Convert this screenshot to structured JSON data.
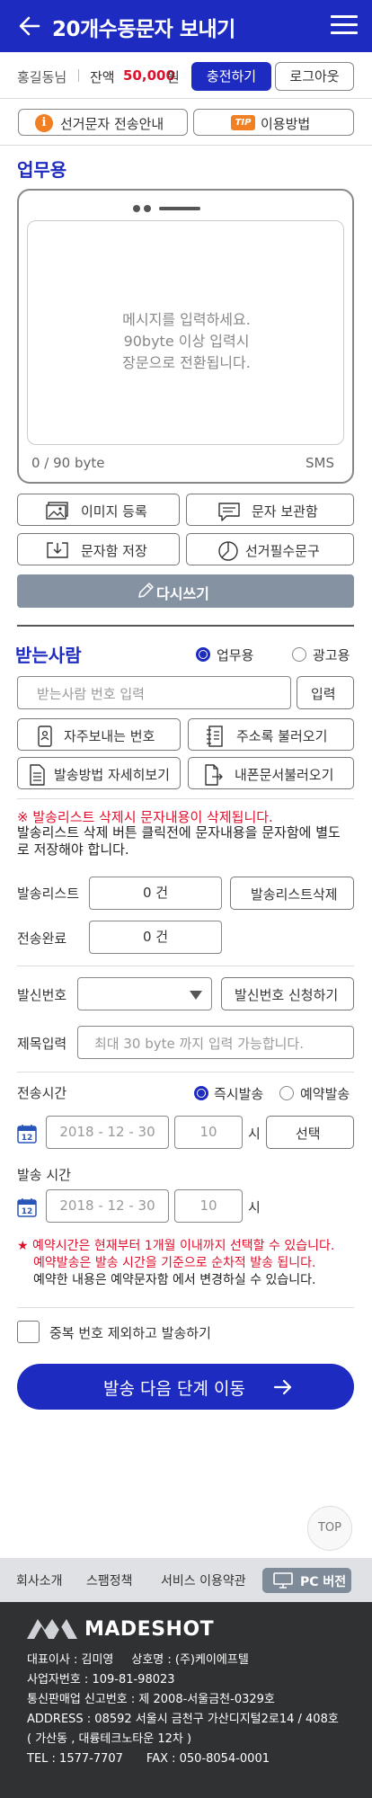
{
  "header": {
    "title": "20개수동문자 보내기",
    "back_icon": "arrow-left-icon",
    "menu_icon": "hamburger-icon"
  },
  "user": {
    "name": "홍길동님",
    "balance_label": "잔액",
    "balance": "50,000",
    "currency": "원",
    "charge": "충전하기",
    "logout": "로그아웃"
  },
  "info_buttons": {
    "election": "선거문자 전송안내",
    "tip_badge": "TIP",
    "usage": "이용방법"
  },
  "compose": {
    "title": "업무용",
    "placeholder_lines": [
      "메시지를 입력하세요.",
      "90byte 이상 입력시",
      "장문으로 전환됩니다."
    ],
    "byte_count": "0 / 90 byte",
    "type": "SMS",
    "buttons": {
      "image": "이미지 등록",
      "storage": "문자 보관함",
      "save": "문자함 저장",
      "election_phrase": "선거필수문구",
      "rewrite": "다시쓰기"
    }
  },
  "recipients": {
    "title": "받는사람",
    "radio_business": "업무용",
    "radio_ad": "광고용",
    "input_placeholder": "받는사람 번호 입력",
    "enter": "입력",
    "frequent": "자주보내는 번호",
    "address_book": "주소록 불러오기",
    "method_detail": "발송방법 자세히보기",
    "phone_docs": "내폰문서불러오기",
    "warn_red": "※ 발송리스트 삭제시 문자내용이 삭제됩니다.",
    "warn_black": "발송리스트 삭제 버튼 클릭전에 문자내용을 문자함에 별도로 저장해야 합니다."
  },
  "counts": {
    "send_list_label": "발송리스트",
    "send_list_value": "0 건",
    "delete_list": "발송리스트삭제",
    "sent_label": "전송완료",
    "sent_value": "0 건"
  },
  "sender": {
    "label": "발신번호",
    "apply": "발신번호 신청하기"
  },
  "subject": {
    "label": "제목입력",
    "placeholder": "최대 30 byte 까지 입력 가능합니다."
  },
  "schedule": {
    "label": "전송시간",
    "immediate": "즉시발송",
    "reserved": "예약발송",
    "date": "2018 - 12 - 30",
    "hour": "10",
    "hour_unit": "시",
    "select": "선택",
    "calendar_day": "12",
    "send_time_label": "발송 시간",
    "date2": "2018 - 12 - 30",
    "hour2": "10"
  },
  "notice": {
    "line1": "★ 예약시간은 현재부터 1개월 이내까지 선택할 수 있습니다.",
    "line2": "예약발송은 발송 시간을 기준으로 순차적 발송 됩니다.",
    "line3": "예약한 내용은 예약문자함 에서 변경하실 수 있습니다."
  },
  "dedupe": "중복 번호 제외하고 발송하기",
  "next": "발송 다음 단계 이동",
  "top": "TOP",
  "footer_nav": {
    "company": "회사소개",
    "spam": "스팸정책",
    "terms": "서비스 이용약관",
    "pc": "PC 버전"
  },
  "footer": {
    "logo": "MADESHOT",
    "ceo": "대표이사 : 김미영",
    "company": "상호명 : (주)케이에프텔",
    "biz_no": "사업자번호 : 109-81-98023",
    "ecommerce": "통신판매업 신고번호 : 제 2008-서울금천-0329호",
    "address": "ADDRESS : 08592 서울시 금천구 가산디지털2로14 / 408호",
    "address2": "( 가산동 , 대륭테크노타운 12차 )",
    "tel": "TEL : 1577-7707",
    "fax": "FAX : 050-8054-0001"
  },
  "colors": {
    "primary": "#1e2bc0",
    "red": "#e0102d",
    "orange": "#f08022",
    "gray_button": "#8492a2",
    "footer_bg": "#2f3133"
  }
}
